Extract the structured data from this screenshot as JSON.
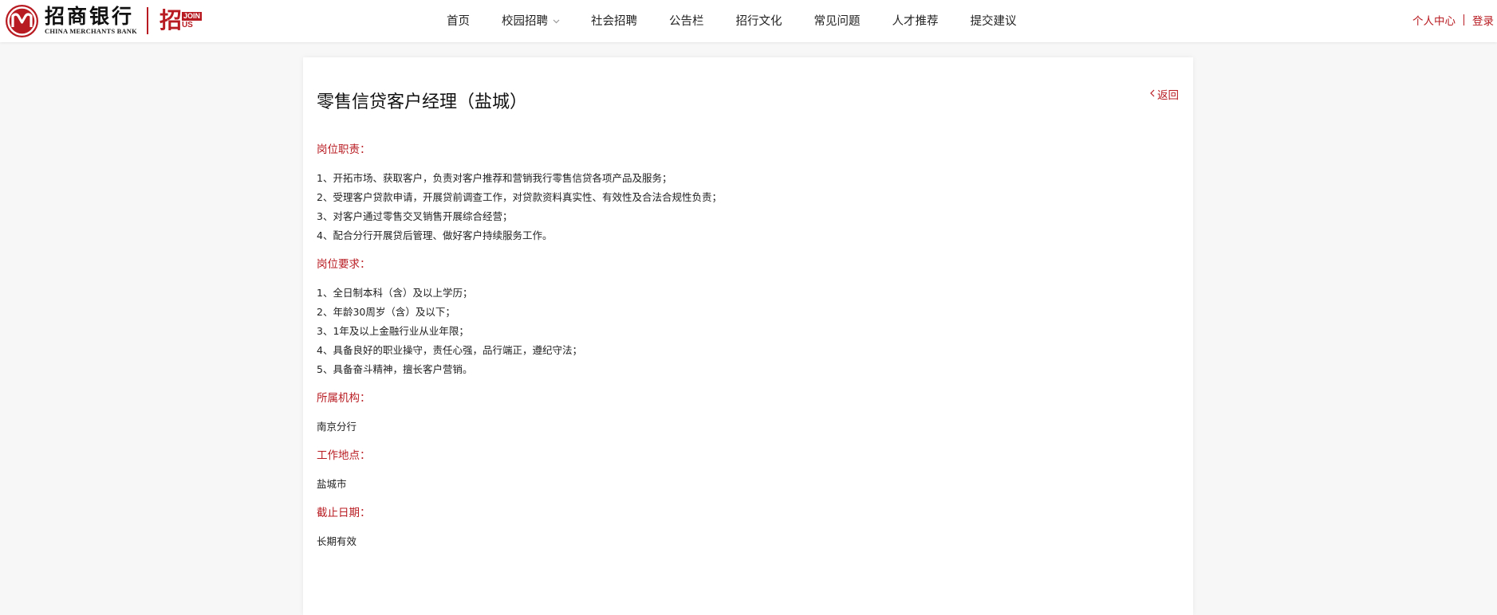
{
  "header": {
    "logo_cn": "招商银行",
    "logo_en": "CHINA MERCHANTS BANK",
    "join_zhao": "招",
    "join_join": "JOIN",
    "join_us": "US",
    "nav": [
      {
        "label": "首页",
        "dropdown": false
      },
      {
        "label": "校园招聘",
        "dropdown": true
      },
      {
        "label": "社会招聘",
        "dropdown": false
      },
      {
        "label": "公告栏",
        "dropdown": false
      },
      {
        "label": "招行文化",
        "dropdown": false
      },
      {
        "label": "常见问题",
        "dropdown": false
      },
      {
        "label": "人才推荐",
        "dropdown": false
      },
      {
        "label": "提交建议",
        "dropdown": false
      }
    ],
    "user_center": "个人中心",
    "login": "登录"
  },
  "job": {
    "title": "零售信贷客户经理（盐城）",
    "back_label": "返回",
    "sections": [
      {
        "heading": "岗位职责：",
        "lines": [
          "1、开拓市场、获取客户，负责对客户推荐和营销我行零售信贷各项产品及服务；",
          "2、受理客户贷款申请，开展贷前调查工作，对贷款资料真实性、有效性及合法合规性负责；",
          "3、对客户通过零售交叉销售开展综合经营；",
          "4、配合分行开展贷后管理、做好客户持续服务工作。"
        ]
      },
      {
        "heading": "岗位要求：",
        "lines": [
          "1、全日制本科（含）及以上学历；",
          "2、年龄30周岁（含）及以下；",
          "3、1年及以上金融行业从业年限；",
          "4、具备良好的职业操守，责任心强，品行端正，遵纪守法；",
          "5、具备奋斗精神，擅长客户营销。"
        ]
      },
      {
        "heading": "所属机构：",
        "lines": [
          "南京分行"
        ]
      },
      {
        "heading": "工作地点：",
        "lines": [
          "盐城市"
        ]
      },
      {
        "heading": "截止日期：",
        "lines": [
          "长期有效"
        ]
      }
    ]
  },
  "colors": {
    "brand_red": "#b81c22",
    "text": "#222222",
    "background": "#f7f7f7"
  },
  "icons": {
    "nav_dropdown": "chevron-down-icon",
    "back": "chevron-left-icon",
    "logo": "cmb-logo-icon"
  }
}
